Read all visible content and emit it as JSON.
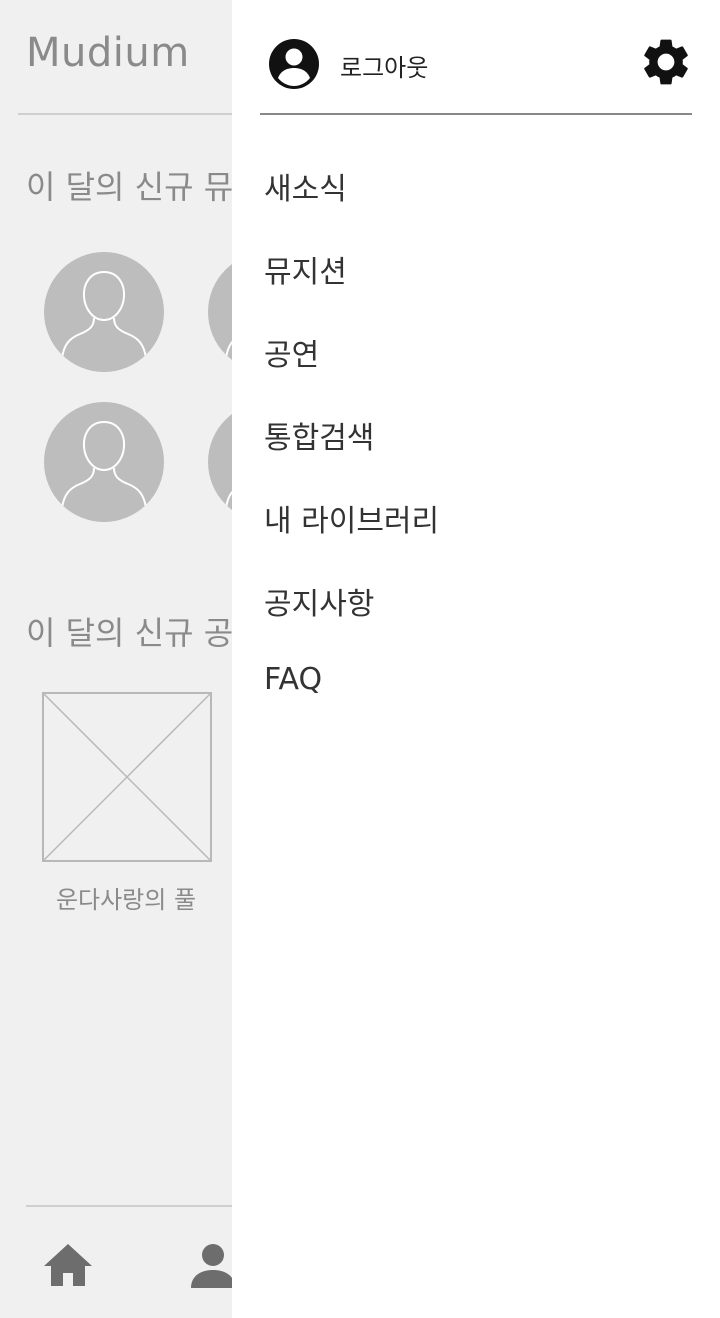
{
  "app": {
    "title": "Mudium"
  },
  "background": {
    "section_musicians_title": "이 달의 신규 뮤",
    "section_shows_title": "이 달의 신규 공",
    "poster_caption": "운다사랑의 풀"
  },
  "drawer": {
    "logout_label": "로그아웃",
    "menu": [
      {
        "label": "새소식"
      },
      {
        "label": "뮤지션"
      },
      {
        "label": "공연"
      },
      {
        "label": "통합검색"
      },
      {
        "label": "내 라이브러리"
      },
      {
        "label": "공지사항"
      },
      {
        "label": "FAQ"
      }
    ]
  },
  "icons": {
    "account": "account-circle-icon",
    "settings": "gear-icon",
    "home": "home-icon",
    "person": "person-icon"
  },
  "colors": {
    "background": "#f0f0f0",
    "drawer": "#ffffff",
    "avatar": "#bdbdbd",
    "muted_text": "#8a8a8a",
    "text": "#333333"
  }
}
